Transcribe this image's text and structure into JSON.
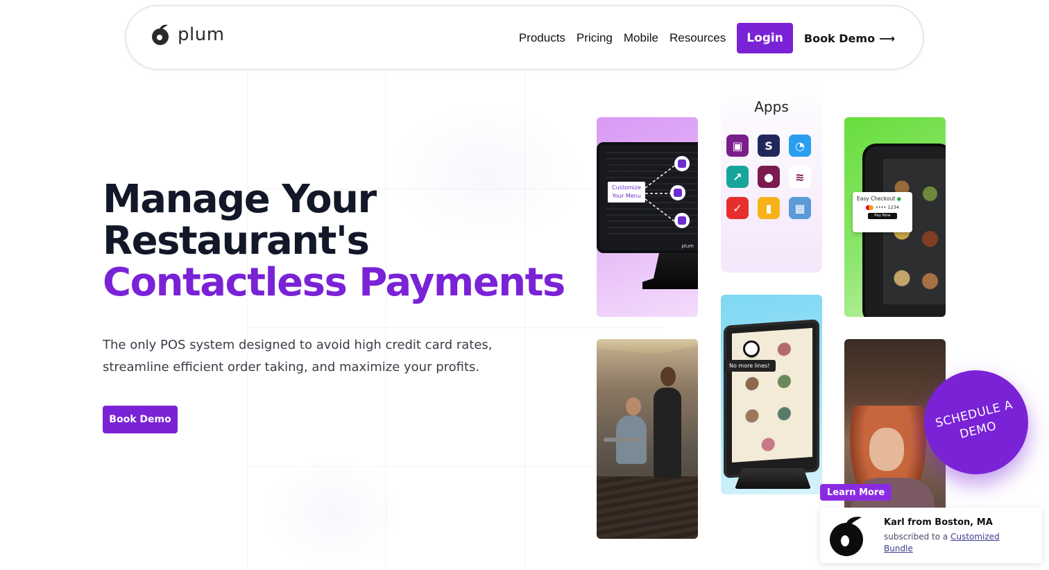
{
  "brand": {
    "name": "plum",
    "color": "#7a22d6"
  },
  "nav": {
    "links": [
      "Products",
      "Pricing",
      "Mobile",
      "Resources"
    ],
    "login": "Login",
    "book_demo": "Book Demo",
    "arrow": "⟶"
  },
  "hero": {
    "title_line1": "Manage Your",
    "title_line2": "Restaurant's",
    "title_line3": "Contactless Payments",
    "subtitle": "The only POS system designed to avoid high credit card rates, streamline efficient order taking, and maximize your profits.",
    "cta": "Book Demo"
  },
  "cards": {
    "pos": {
      "label": "Customize Your Menu",
      "brand": "plum"
    },
    "apps": {
      "title": "Apps",
      "icons": [
        {
          "name": "ordering-app-icon",
          "color": "#7a1f8a",
          "glyph": "▣"
        },
        {
          "name": "s-app-icon",
          "color": "#22285a",
          "glyph": "S"
        },
        {
          "name": "swirl-app-icon",
          "color": "#2a9ff0",
          "glyph": "◔"
        },
        {
          "name": "growth-app-icon",
          "color": "#17a59a",
          "glyph": "↗"
        },
        {
          "name": "plum-app-icon",
          "color": "#7a1a4f",
          "glyph": "●"
        },
        {
          "name": "wifi-app-icon",
          "color": "#ffffff",
          "glyph": "≋"
        },
        {
          "name": "checkmark-app-icon",
          "color": "#e62e2e",
          "glyph": "✓"
        },
        {
          "name": "audio-app-icon",
          "color": "#f7b21a",
          "glyph": "▮"
        },
        {
          "name": "calendar-app-icon",
          "color": "#5a9ad6",
          "glyph": "▦"
        }
      ]
    },
    "phone": {
      "checkout_title": "Easy Checkout",
      "card_number": "•••• 1234",
      "pay_button": "Pay Now"
    },
    "kiosk": {
      "tag": "No more lines!"
    }
  },
  "schedule": {
    "line1": "SCHEDULE A",
    "line2": "DEMO"
  },
  "notification": {
    "learn_more": "Learn More",
    "name": "Karl from Boston, MA",
    "message_prefix": "subscribed to a",
    "message_link": "Customized Bundle"
  }
}
